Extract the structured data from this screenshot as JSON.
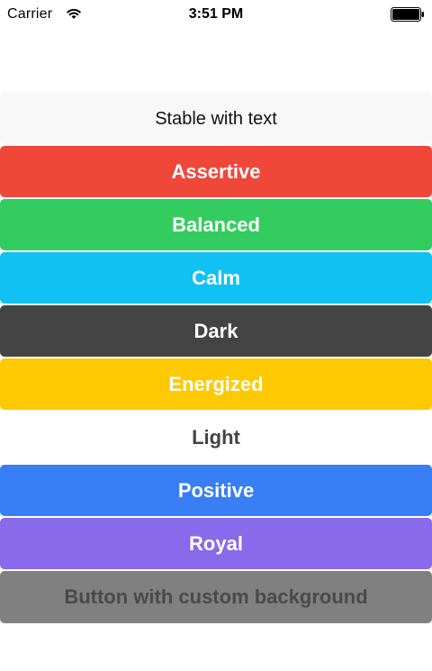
{
  "status_bar": {
    "carrier": "Carrier",
    "time": "3:51 PM",
    "icons": [
      "wifi-icon",
      "battery-icon"
    ]
  },
  "buttons": [
    {
      "label": "Stable with text",
      "style": "stable",
      "color": "#f8f8f8"
    },
    {
      "label": "Assertive",
      "style": "assertive",
      "color": "#ef473a"
    },
    {
      "label": "Balanced",
      "style": "balanced",
      "color": "#33cd5f"
    },
    {
      "label": "Calm",
      "style": "calm",
      "color": "#11c1f3"
    },
    {
      "label": "Dark",
      "style": "dark",
      "color": "#444444"
    },
    {
      "label": "Energized",
      "style": "energized",
      "color": "#ffc900"
    },
    {
      "label": "Light",
      "style": "light",
      "color": "#ffffff"
    },
    {
      "label": "Positive",
      "style": "positive",
      "color": "#387ef5"
    },
    {
      "label": "Royal",
      "style": "royal",
      "color": "#886aea"
    },
    {
      "label": "Button with custom background",
      "style": "custom",
      "color": "#808080"
    }
  ]
}
